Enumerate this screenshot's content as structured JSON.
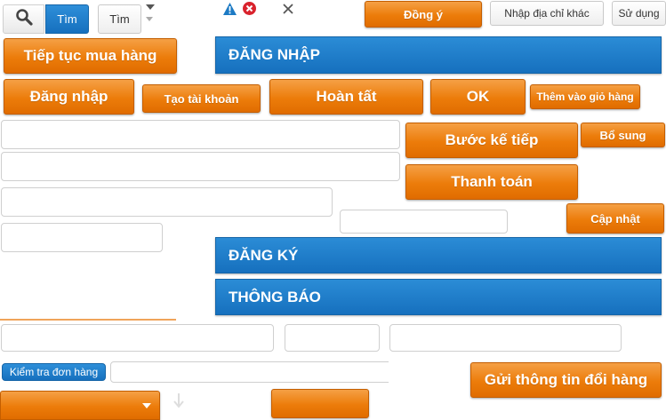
{
  "search": {
    "search_icon": "magnifier-icon",
    "tim_blue_label": "Tìm",
    "tim_gray_label": "Tìm"
  },
  "status_icons": {
    "warning": "warning-icon",
    "error": "error-icon",
    "close": "close-icon"
  },
  "top_buttons": {
    "dong_y": "Đồng ý",
    "nhap_dia_chi_khac": "Nhập địa chỉ khác",
    "su_dung": "Sử dụng"
  },
  "buttons": {
    "tiep_tuc_mua_hang": "Tiếp tục mua hàng",
    "dang_nhap": "Đăng nhập",
    "tao_tai_khoan": "Tạo tài khoản",
    "hoan_tat": "Hoàn tất",
    "ok": "OK",
    "them_vao_gio_hang": "Thêm vào giỏ hàng",
    "buoc_ke_tiep": "Bước kế tiếp",
    "bo_sung": "Bổ sung",
    "thanh_toan": "Thanh toán",
    "cap_nhat": "Cập nhật",
    "kiem_tra_don_hang": "Kiểm tra đơn hàng",
    "gui_thong_tin_doi_hang": "Gửi thông tin đổi hàng"
  },
  "bars": {
    "dang_nhap": "ĐĂNG NHẬP",
    "dang_ky": "ĐĂNG KÝ",
    "thong_bao": "THÔNG BÁO"
  },
  "inputs": {
    "field_1": "",
    "field_2": "",
    "field_3": "",
    "field_4": "",
    "field_5": "",
    "field_6": "",
    "field_7": "",
    "field_8": "",
    "field_9": ""
  },
  "colors": {
    "orange": "#ec7c0a",
    "blue_bar": "#1b78c6",
    "blue_button": "#1a75c4"
  }
}
